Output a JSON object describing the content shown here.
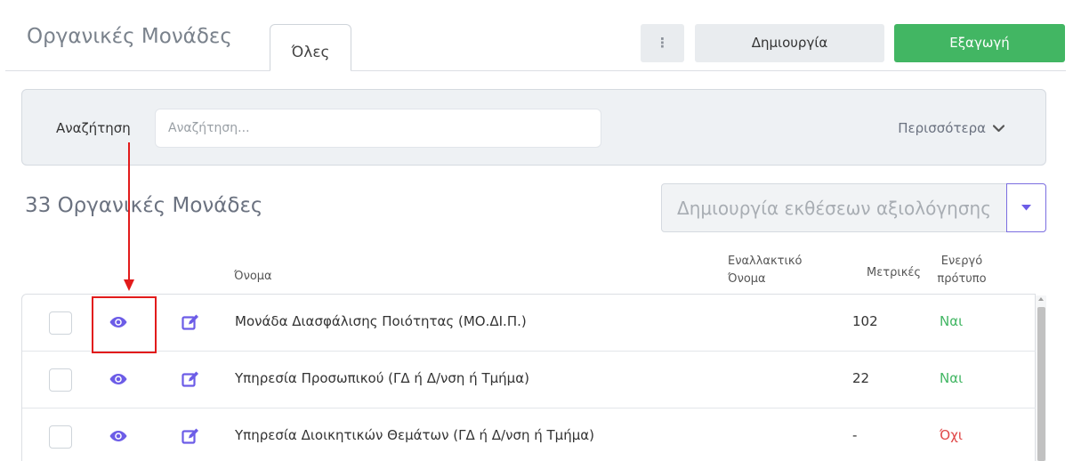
{
  "header": {
    "title": "Οργανικές Μονάδες",
    "tab_all": "Όλες",
    "kebab_icon": "more-vertical-icon",
    "create_label": "Δημιουργία",
    "export_label": "Εξαγωγή"
  },
  "search": {
    "label": "Αναζήτηση",
    "placeholder": "Αναζήτηση...",
    "value": "",
    "more_label": "Περισσότερα"
  },
  "list": {
    "count_title": "33 Οργανικές Μονάδες",
    "report_button": "Δημιουργία εκθέσεων αξιολόγησης"
  },
  "table": {
    "columns": {
      "name": "Όνομα",
      "alt_name_line1": "Εναλλακτικό",
      "alt_name_line2": "Όνομα",
      "metrics": "Μετρικές",
      "active_line1": "Ενεργό",
      "active_line2": "πρότυπο"
    },
    "rows": [
      {
        "name": "Μονάδα Διασφάλισης Ποιότητας (ΜΟ.ΔΙ.Π.)",
        "alt_name": "",
        "metrics": "102",
        "active": "Ναι"
      },
      {
        "name": "Υπηρεσία Προσωπικού (ΓΔ ή Δ/νση ή Τμήμα)",
        "alt_name": "",
        "metrics": "22",
        "active": "Ναι"
      },
      {
        "name": "Υπηρεσία Διοικητικών Θεμάτων (ΓΔ ή Δ/νση ή Τμήμα)",
        "alt_name": "",
        "metrics": "-",
        "active": "Όχι"
      }
    ]
  },
  "colors": {
    "accent": "#6c5ce7",
    "export_green": "#42b663",
    "yes_green": "#42b663",
    "no_red": "#e04848",
    "annotation_red": "#e21b1b"
  },
  "icons": {
    "view": "eye-icon",
    "edit": "edit-icon",
    "more": "chevron-down-icon",
    "report_caret": "caret-down-icon"
  }
}
